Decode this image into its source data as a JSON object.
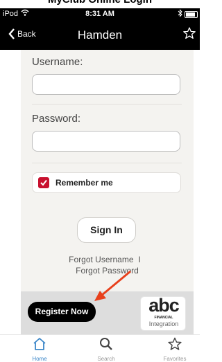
{
  "caption": "MyClub Online Login",
  "status_bar": {
    "carrier": "iPod",
    "time": "8:31 AM"
  },
  "nav_bar": {
    "back_label": "Back",
    "title": "Hamden"
  },
  "form": {
    "username_label": "Username:",
    "username_value": "",
    "password_label": "Password:",
    "password_value": "",
    "remember_label": "Remember me",
    "remember_checked": true,
    "signin_label": "Sign In",
    "forgot_username": "Forgot Username",
    "separator": "I",
    "forgot_password": "Forgot Password"
  },
  "footer": {
    "register_label": "Register Now",
    "logo": {
      "main": "abc",
      "sub": "FINANCIAL",
      "tag": "Integration"
    }
  },
  "tab_bar": {
    "tabs": [
      {
        "label": "Home",
        "icon": "home-icon"
      },
      {
        "label": "Search",
        "icon": "search-icon"
      },
      {
        "label": "Favorites",
        "icon": "star-icon"
      }
    ]
  },
  "colors": {
    "accent_red": "#c8102e",
    "tab_active": "#3a86c8",
    "annotation_arrow": "#e8401c"
  }
}
